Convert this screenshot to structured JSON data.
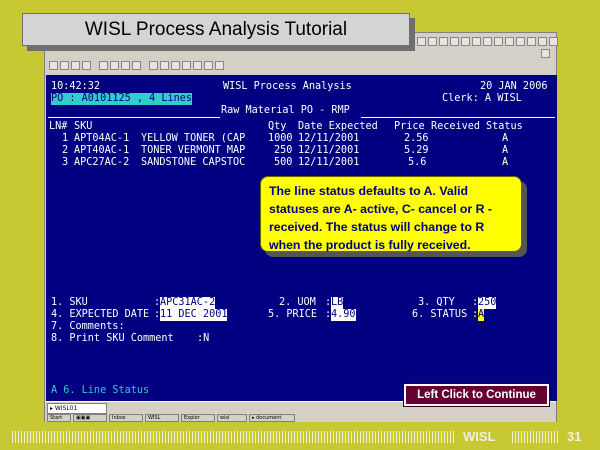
{
  "slide": {
    "title": "WISL Process Analysis Tutorial",
    "footer_brand": "WISL",
    "page_number": "31"
  },
  "terminal": {
    "time": "10:42:32",
    "app_title": "WISL Process Analysis",
    "date": "20 JAN 2006",
    "po_line": "PO : A0101125 , 4 Lines",
    "screen_title": "Raw Material PO - RMP",
    "clerk": "Clerk: A WISL",
    "table": {
      "headers": [
        "LN#",
        "SKU",
        "Qty",
        "Date Expected",
        "Price",
        "Received",
        "Status"
      ],
      "rows": [
        {
          "ln": "1",
          "sku": "APT04AC-1",
          "desc": "YELLOW TONER (CAP",
          "qty": "1000",
          "date": "12/11/2001",
          "price": "2.56",
          "status": "A"
        },
        {
          "ln": "2",
          "sku": "APT40AC-1",
          "desc": "TONER VERMONT MAP",
          "qty": "250",
          "date": "12/11/2001",
          "price": "5.29",
          "status": "A"
        },
        {
          "ln": "3",
          "sku": "APC27AC-2",
          "desc": "SANDSTONE CAPSTOC",
          "qty": "500",
          "date": "12/11/2001",
          "price": "5.6",
          "status": "A"
        }
      ]
    },
    "form": {
      "sku_label": "1. SKU",
      "sku_value": "APC31AC-2",
      "uom_label": "2. UOM",
      "uom_value": "LB",
      "qty_label": "3. QTY",
      "qty_value": "250",
      "expected_label": "4. EXPECTED DATE",
      "expected_value": "11 DEC 2001",
      "price_label": "5. PRICE",
      "price_value": "4.90",
      "status_label": "6. STATUS",
      "status_value": "A",
      "comments_label": "7. Comments:",
      "print_label": "8. Print SKU Comment",
      "print_value": ":N"
    },
    "prompt": "A 6. Line Status"
  },
  "callout": {
    "text": "The line status defaults to A. Valid statuses are A- active, C- cancel or R - received. The status will change to R when the product is fully received."
  },
  "continue_button": {
    "label": "Left Click to Continue"
  },
  "colors": {
    "slide_bg": "#c8c832",
    "terminal_bg": "#000080",
    "cyan": "#33cccc",
    "callout_bg": "#ffff00",
    "button_bg": "#660033"
  }
}
